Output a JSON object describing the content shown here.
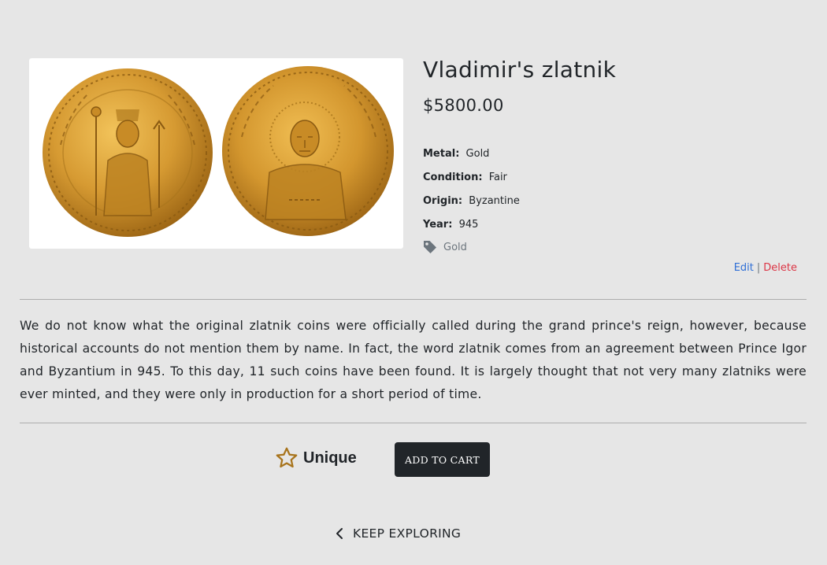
{
  "product": {
    "title": "Vladimir's zlatnik",
    "price": "$5800.00",
    "specs": [
      {
        "label": "Metal:",
        "value": "Gold"
      },
      {
        "label": "Condition:",
        "value": "Fair"
      },
      {
        "label": "Origin:",
        "value": "Byzantine"
      },
      {
        "label": "Year:",
        "value": "945"
      }
    ],
    "tag": "Gold",
    "description": "We do not know what the original zlatnik coins were officially called during the grand prince's reign, however, because historical accounts do not mention them by name. In fact, the word zlatnik comes from an agreement between Prince Igor and Byzantium in 945. To this day, 11 such coins have been found. It is largely thought that not very many zlatniks were ever minted, and they were only in production for a short period of time.",
    "unique_label": "Unique"
  },
  "admin": {
    "edit_label": "Edit",
    "separator": "|",
    "delete_label": "Delete"
  },
  "actions": {
    "add_to_cart_label": "ADD TO CART",
    "keep_exploring_label": "KEEP EXPLORING"
  },
  "icons": {
    "tag": "tag-icon",
    "star": "star-outline-icon",
    "back": "chevron-left-icon"
  },
  "colors": {
    "page_background": "#e6e6e6",
    "text": "#212529",
    "button_background": "#212529",
    "button_text": "#ffffff",
    "edit_link": "#2f6fd6",
    "delete_link": "#dc3545",
    "star": "#a8741c",
    "coin_gold": "#c8912a"
  }
}
